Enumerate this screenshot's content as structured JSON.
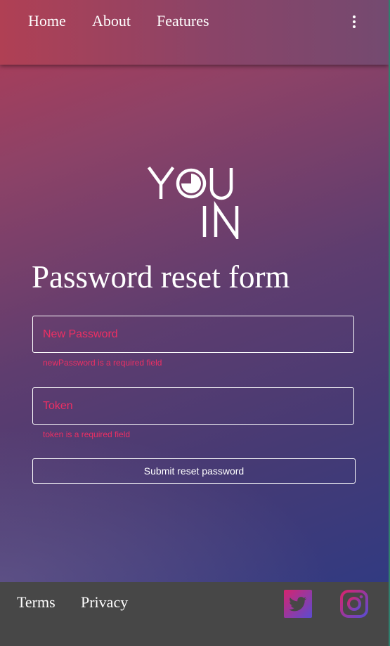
{
  "nav": {
    "links": [
      {
        "label": "Home"
      },
      {
        "label": "About"
      },
      {
        "label": "Features"
      }
    ],
    "menu_icon": "kebab-menu-icon"
  },
  "logo": {
    "text_top": "YOU",
    "text_bottom": "IN"
  },
  "form": {
    "title": "Password reset form",
    "new_password": {
      "placeholder": "New Password",
      "value": "",
      "error": "newPassword is a required field"
    },
    "token": {
      "placeholder": "Token",
      "value": "",
      "error": "token is a required field"
    },
    "submit_label": "Submit reset password"
  },
  "footer": {
    "links": [
      {
        "label": "Terms"
      },
      {
        "label": "Privacy"
      }
    ],
    "social": [
      {
        "icon": "twitter-icon"
      },
      {
        "icon": "instagram-icon"
      }
    ]
  },
  "colors": {
    "error": "#ee2f63",
    "footer_bg": "#474747",
    "social_gradient_start": "#d6246e",
    "social_gradient_end": "#5b4bd0"
  }
}
